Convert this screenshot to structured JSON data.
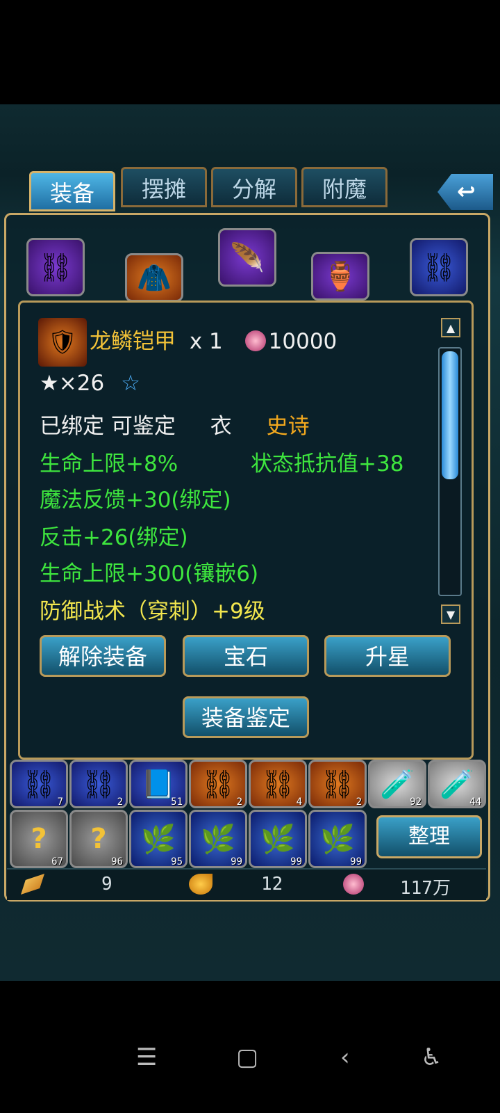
{
  "tabs": [
    {
      "label": "装备",
      "active": true
    },
    {
      "label": "摆摊",
      "active": false
    },
    {
      "label": "分解",
      "active": false
    },
    {
      "label": "附魔",
      "active": false
    }
  ],
  "back_icon": "back-arrow-icon",
  "item": {
    "name": "龙鳞铠甲",
    "quantity": "x 1",
    "price": "10000",
    "stars": "★×26",
    "star_symbol": "☆",
    "bind_status": "已绑定 可鉴定",
    "slot_type": "衣",
    "quality": "史诗",
    "stats": [
      "生命上限+8%",
      "状态抵抗值+38",
      "魔法反馈+30(绑定)",
      "反击+26(绑定)",
      "生命上限+300(镶嵌6)"
    ],
    "skill": "防御战术（穿刺）+9级"
  },
  "buttons": {
    "unequip": "解除装备",
    "gem": "宝石",
    "upgrade_star": "升星",
    "identify": "装备鉴定",
    "tidy": "整理"
  },
  "bag": {
    "row1_counts": [
      "7",
      "2",
      "51",
      "2",
      "4",
      "2",
      "92",
      "44"
    ],
    "row2_counts": [
      "67",
      "96",
      "95",
      "99",
      "99",
      "99"
    ]
  },
  "currency": {
    "gold_bars": "9",
    "leaves": "12",
    "coins": "117万"
  },
  "colors": {
    "accent": "#c9a866",
    "stat_green": "#3ee63e",
    "name_gold": "#f2c238"
  }
}
